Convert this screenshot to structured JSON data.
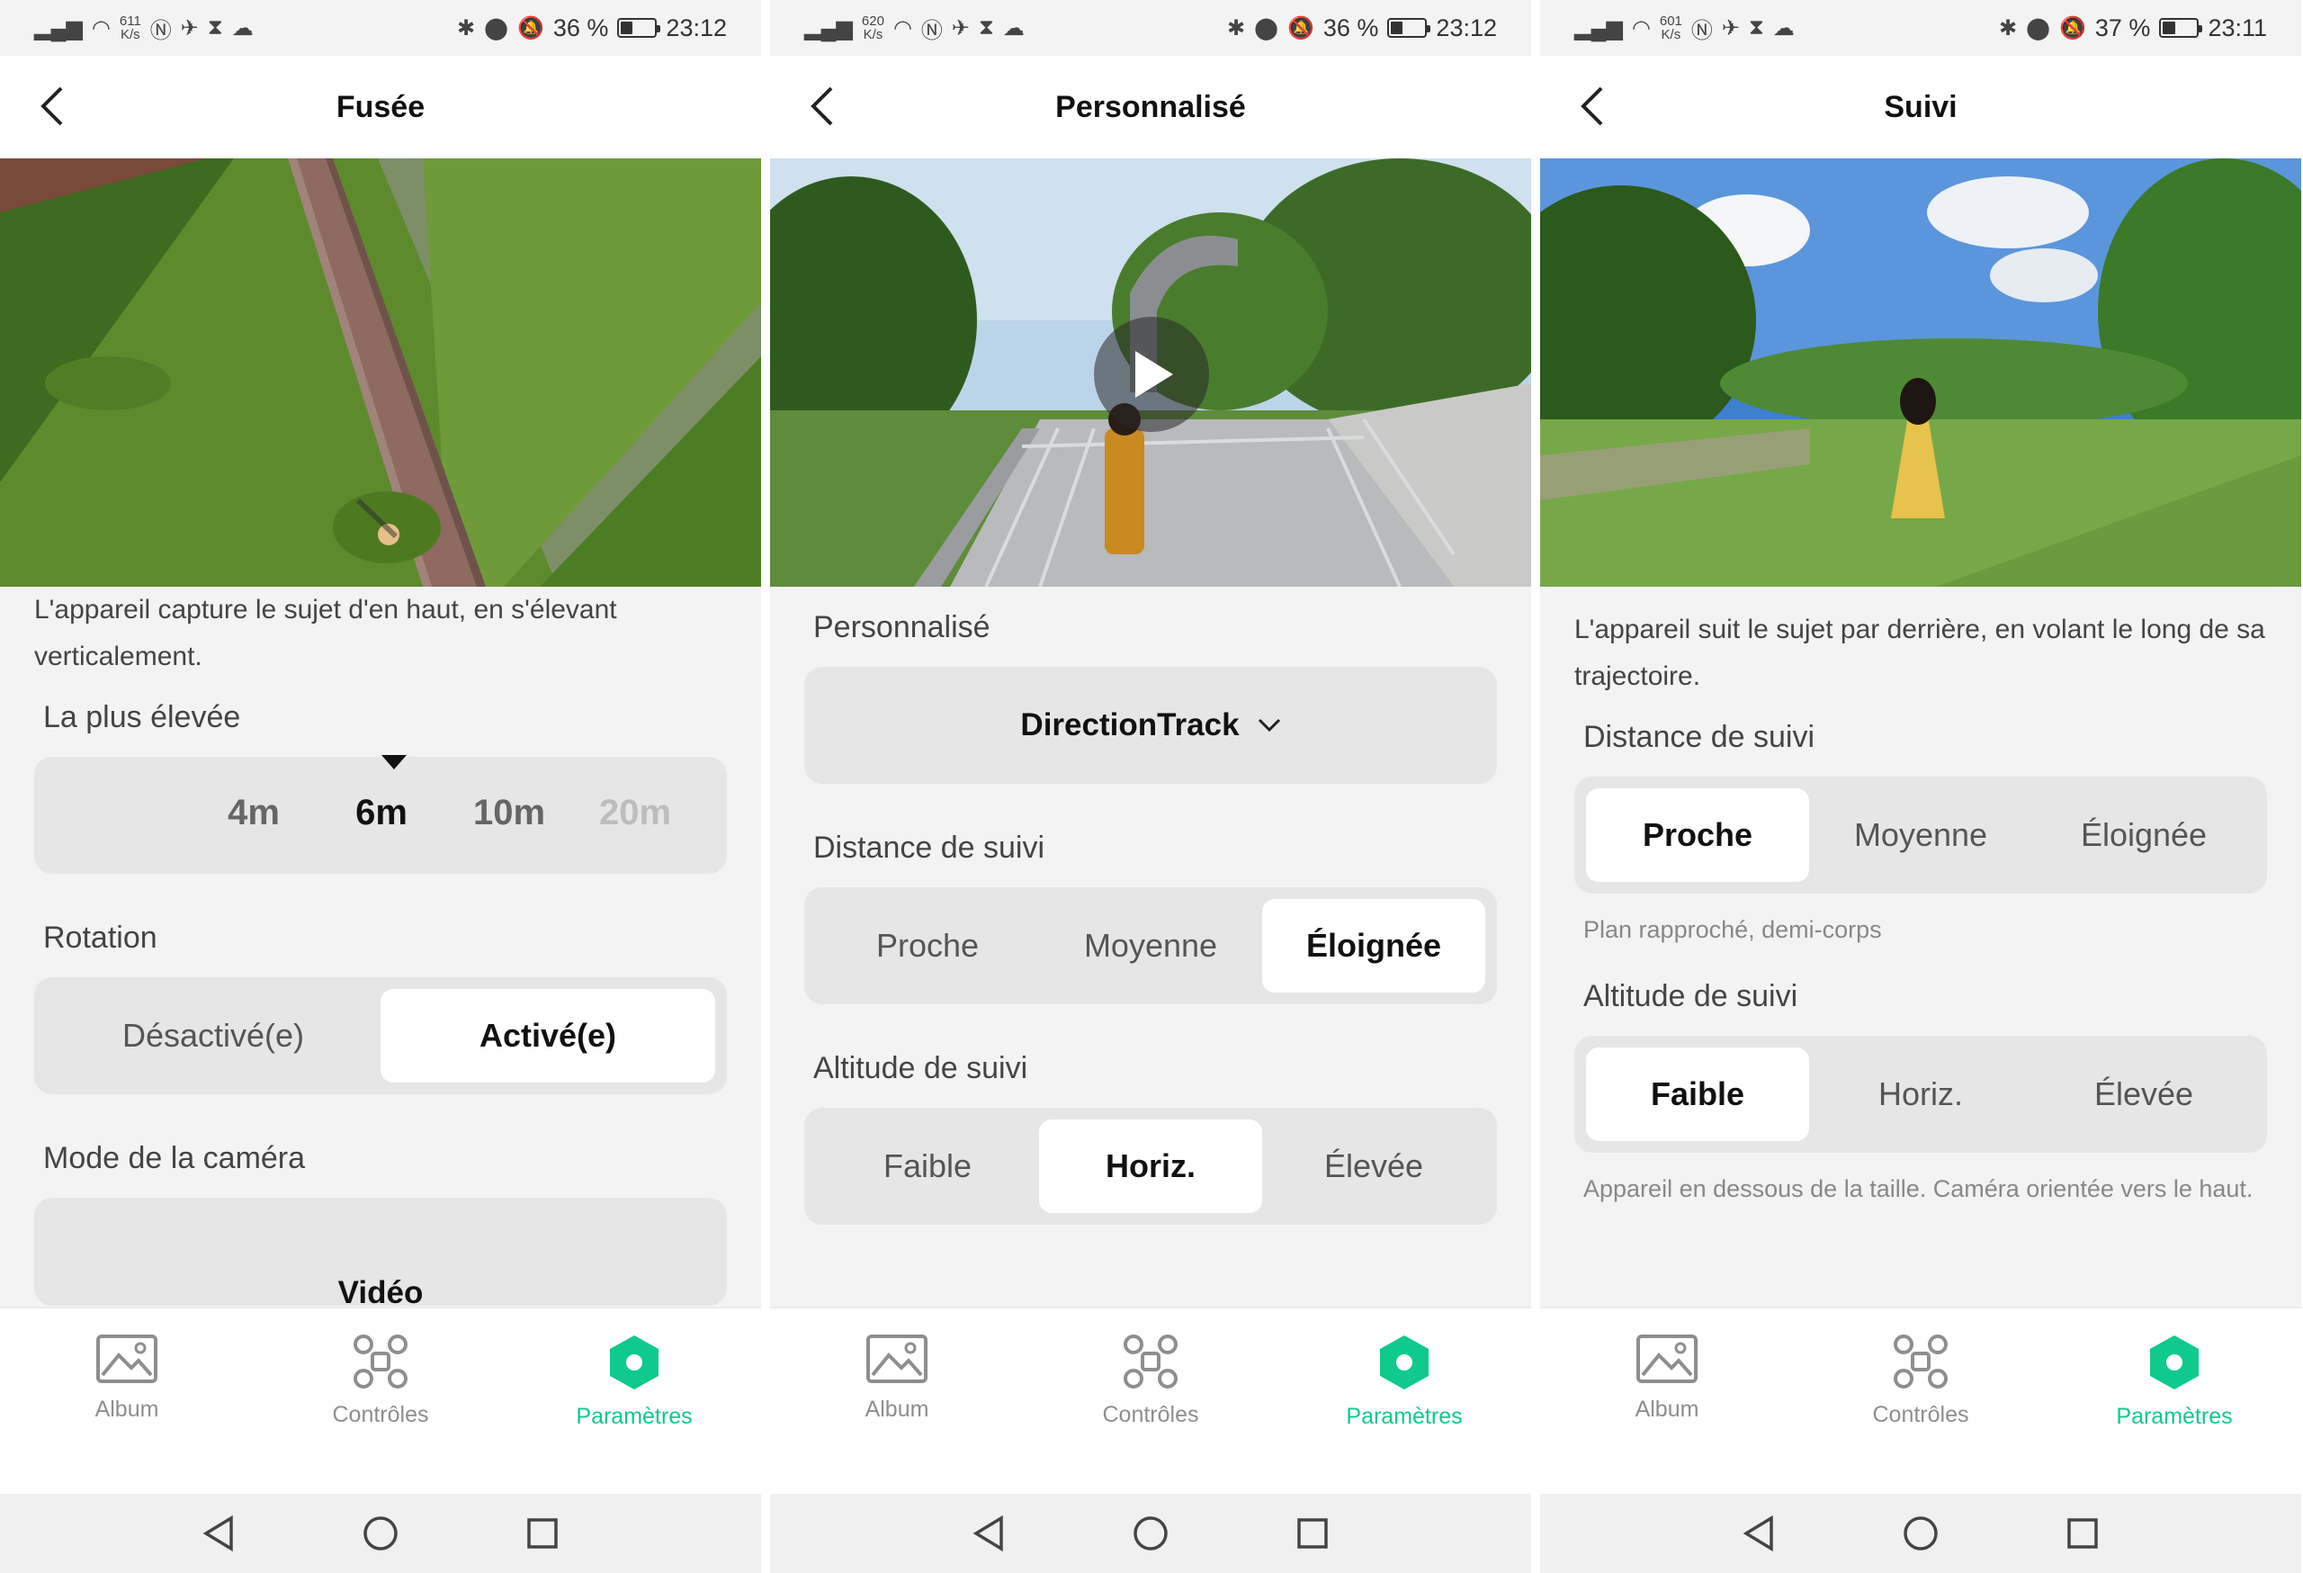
{
  "colors": {
    "accent": "#10c98d",
    "page_bg": "#f3f3f3",
    "seg_bg": "#e6e6e6"
  },
  "phones": [
    {
      "status": {
        "speed_value": "611",
        "speed_unit": "K/s",
        "battery": "36 %",
        "battery_level": 0.36,
        "time": "23:12"
      },
      "title": "Fusée",
      "description": "L'appareil capture le sujet d'en haut, en s'élevant verticalement.",
      "height_label": "La plus élevée",
      "height_options": [
        "4m",
        "6m",
        "10m",
        "20m"
      ],
      "height_selected": "6m",
      "rotation_label": "Rotation",
      "rotation_options": [
        "Désactivé(e)",
        "Activé(e)"
      ],
      "rotation_selected": "Activé(e)",
      "camera_label": "Mode de la caméra",
      "camera_value": "Vidéo"
    },
    {
      "status": {
        "speed_value": "620",
        "speed_unit": "K/s",
        "battery": "36 %",
        "battery_level": 0.36,
        "time": "23:12"
      },
      "title": "Personnalisé",
      "custom_label": "Personnalisé",
      "custom_value": "DirectionTrack",
      "distance_label": "Distance de suivi",
      "distance_options": [
        "Proche",
        "Moyenne",
        "Éloignée"
      ],
      "distance_selected": "Éloignée",
      "altitude_label": "Altitude de suivi",
      "altitude_options": [
        "Faible",
        "Horiz.",
        "Élevée"
      ],
      "altitude_selected": "Horiz."
    },
    {
      "status": {
        "speed_value": "601",
        "speed_unit": "K/s",
        "battery": "37 %",
        "battery_level": 0.37,
        "time": "23:11"
      },
      "title": "Suivi",
      "description": "L'appareil suit le sujet par derrière, en volant le long de sa trajectoire.",
      "distance_label": "Distance de suivi",
      "distance_options": [
        "Proche",
        "Moyenne",
        "Éloignée"
      ],
      "distance_selected": "Proche",
      "distance_hint": "Plan rapproché, demi-corps",
      "altitude_label": "Altitude de suivi",
      "altitude_options": [
        "Faible",
        "Horiz.",
        "Élevée"
      ],
      "altitude_selected": "Faible",
      "altitude_hint": "Appareil en dessous de la taille. Caméra orientée vers le haut."
    }
  ],
  "tabs": [
    {
      "label": "Album",
      "icon": "album-icon"
    },
    {
      "label": "Contrôles",
      "icon": "drone-icon"
    },
    {
      "label": "Paramètres",
      "icon": "settings-hex-icon"
    }
  ],
  "active_tab": "Paramètres"
}
